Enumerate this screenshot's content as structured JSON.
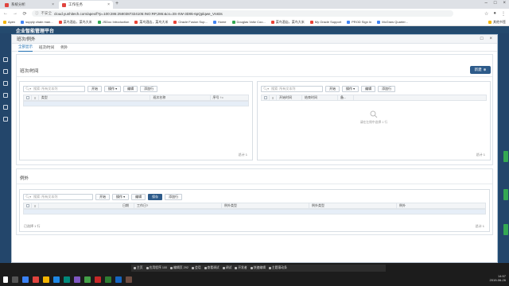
{
  "browser": {
    "tabs": [
      {
        "label": "系统分析",
        "active": false
      },
      {
        "label": "工作任务",
        "active": true
      }
    ],
    "security_label": "不安全",
    "url": "cloud.yunhitech.com/apex/f?p=100:286:2580387324105:INO:RP,286:&cs=3S-XW-3D9k-6pQplqwe_Vn83s",
    "bookmarks": [
      "Apex",
      "supply chain man...",
      "菜鸟酒店，菜鸟大米",
      "JSDoc Introduction",
      "菜鸟酒店，菜鸟大米",
      "Oracle Fusion Sup...",
      "Home",
      "Douglas Voltz Coo...",
      "菜鸟酒店，菜鸟大米",
      "My Oracle Support",
      "PROD Sign In",
      "McGraw Quarter...",
      "其他书签"
    ],
    "bookmarks_right": "其他书签"
  },
  "app": {
    "title": "企业智能管理平台"
  },
  "modal": {
    "title": "班次/例外",
    "tabs": [
      "全部显示",
      "班次/时间",
      "例外"
    ],
    "section1_title": "班次/时间",
    "new_button": "新建",
    "left_grid": {
      "search_placeholder": "搜索: 所有文本列",
      "go": "开始",
      "actions": "操作",
      "edit": "编辑",
      "add_row": "添加行",
      "columns": [
        "类型",
        "班次名称",
        "序号 ↑="
      ],
      "footer": "总计 1"
    },
    "right_grid": {
      "search_placeholder": "搜索: 所有文本列",
      "go": "开始",
      "actions": "操作",
      "edit": "编辑",
      "add_row": "添加行",
      "columns": [
        "开始时间",
        "结束时间",
        "备..."
      ],
      "empty_text": "请在左侧中选择 1 行",
      "footer": "总计 1"
    },
    "section2_title": "例外",
    "bottom_grid": {
      "search_placeholder": "搜索: 所有文本列",
      "go": "开始",
      "actions": "操作",
      "edit": "编辑",
      "save": "保存",
      "add_row": "添加行",
      "columns": [
        "日期",
        "工作日?",
        "例外类型",
        "例外类型",
        "例外"
      ],
      "footer": "已选择 1 行",
      "footer_right": "总计 1"
    }
  },
  "taskbar": {
    "dock_items": [
      "主页",
      "应用程序 100",
      "编辑页 292",
      "会话",
      "查看调试",
      "调试",
      "开发者",
      "快速编辑",
      "主题滚动条"
    ],
    "time": "14:57",
    "date": "2019-06-26"
  },
  "colors": {
    "app_bg": "#1f4e79",
    "primary": "#2e5b8a",
    "selected_row": "#e6eef7",
    "tab_active": "#1f6fb2"
  }
}
